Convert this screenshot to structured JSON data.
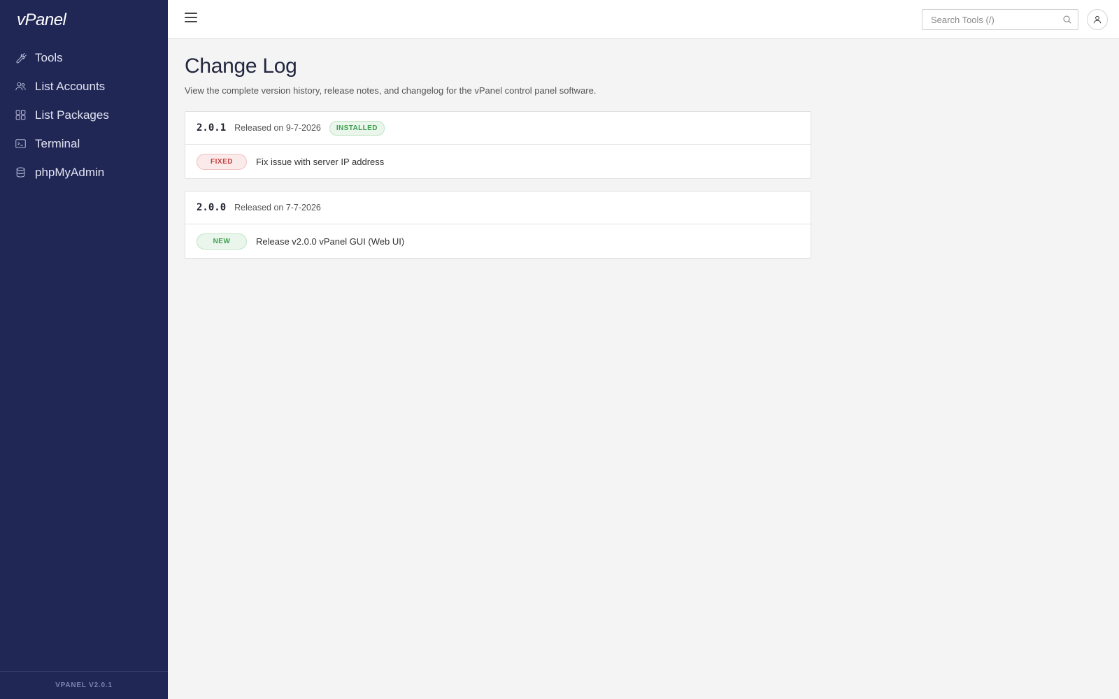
{
  "app": {
    "logo_text": "vPanel",
    "version_footer": "VPANEL V2.0.1"
  },
  "sidebar": {
    "items": [
      {
        "label": "Tools",
        "icon": "wrench-icon"
      },
      {
        "label": "List Accounts",
        "icon": "users-icon"
      },
      {
        "label": "List Packages",
        "icon": "grid-icon"
      },
      {
        "label": "Terminal",
        "icon": "terminal-icon"
      },
      {
        "label": "phpMyAdmin",
        "icon": "database-icon"
      }
    ]
  },
  "header": {
    "search_placeholder": "Search Tools (/)",
    "menu_icon": "hamburger-icon",
    "search_icon": "search-icon",
    "user_icon": "user-icon"
  },
  "main": {
    "title": "Change Log",
    "description": "View the complete version history, release notes, and changelog for the vPanel control panel software.",
    "releases": [
      {
        "version": "2.0.1",
        "released": "Released on 9-7-2026",
        "badge": "INSTALLED",
        "entries": [
          {
            "tag": "FIXED",
            "text": "Fix issue with server IP address"
          }
        ]
      },
      {
        "version": "2.0.0",
        "released": "Released on 7-7-2026",
        "badge": "",
        "entries": [
          {
            "tag": "NEW",
            "text": "Release v2.0.0 vPanel GUI (Web UI)"
          }
        ]
      }
    ]
  },
  "colors": {
    "sidebar_bg": "#212755",
    "page_bg": "#f4f4f4",
    "fixed": "#c63e3e",
    "new": "#3c9f4e"
  }
}
